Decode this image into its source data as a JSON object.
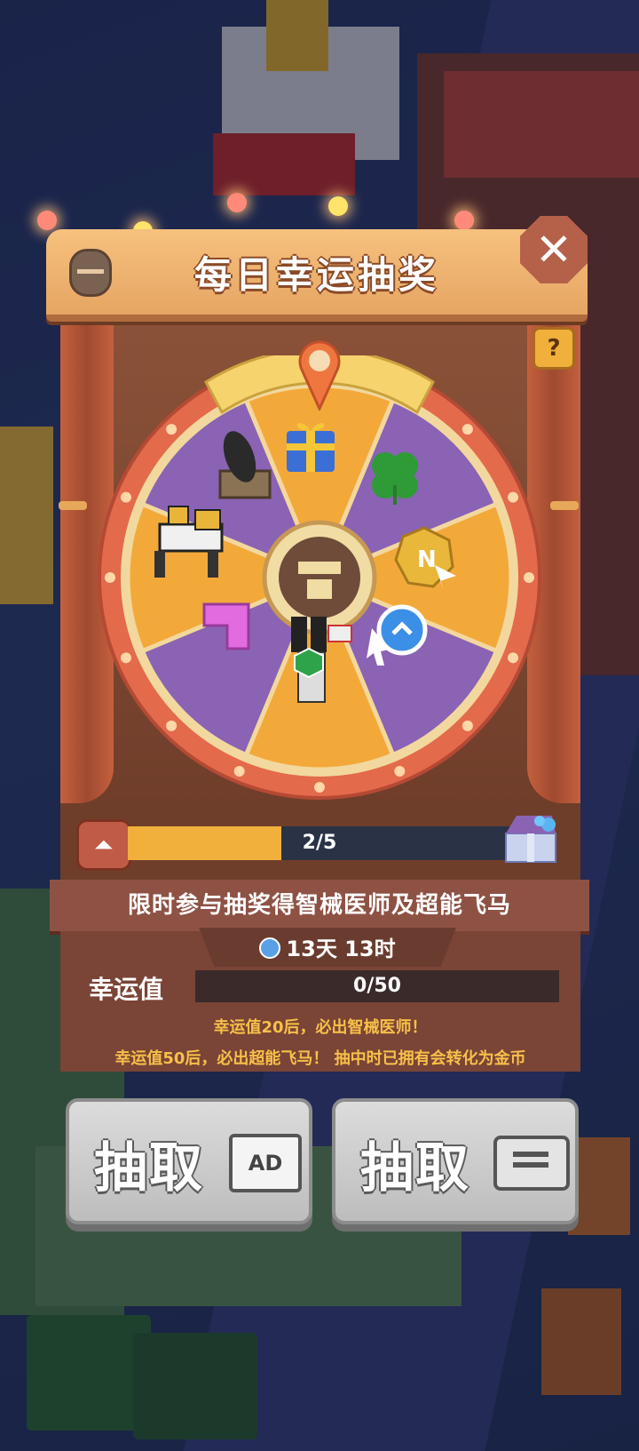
{
  "popup": {
    "title": "每日幸运抽奖",
    "close_icon": "close-icon",
    "help_label": "?"
  },
  "wheel": {
    "prizes": [
      "gift-box",
      "four-leaf-clover",
      "gold-coin",
      "speed-boost",
      "robot-doctor",
      "pink-block",
      "mecha-horse",
      "cannon"
    ],
    "slice_colors": [
      "#f3a93a",
      "#8a63b4"
    ],
    "ring_color": "#e46a4c",
    "center_icon": "wheel-center-icon"
  },
  "progress": {
    "current": 2,
    "total": 5,
    "text": "2/5"
  },
  "event": {
    "promo_text": "限时参与抽奖得智械医师及超能飞马",
    "timer_text": "13天 13时"
  },
  "luck": {
    "label": "幸运值",
    "value_text": "0/50",
    "hint_1": "幸运值20后，必出智械医师！",
    "hint_2": "幸运值50后，必出超能飞马！ 抽中时已拥有会转化为金币"
  },
  "buttons": {
    "draw_ad_label": "抽取",
    "ad_badge": "AD",
    "draw_ticket_label": "抽取"
  }
}
